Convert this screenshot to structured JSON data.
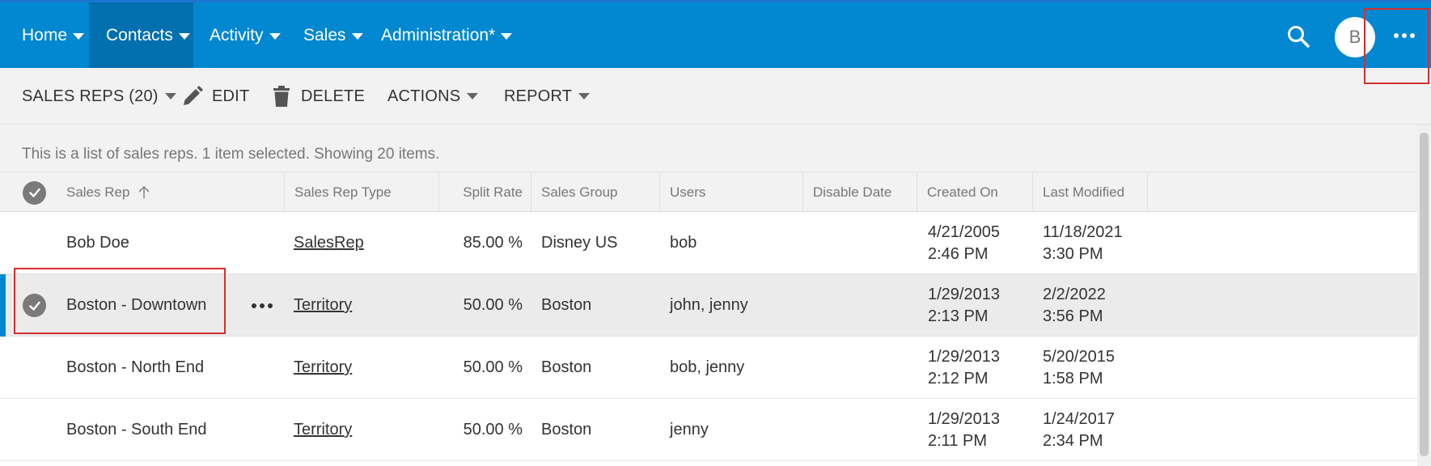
{
  "nav": {
    "items": [
      {
        "label": "Home"
      },
      {
        "label": "Contacts"
      },
      {
        "label": "Activity"
      },
      {
        "label": "Sales"
      },
      {
        "label": "Administration*"
      }
    ],
    "avatar_initial": "B",
    "accent_color": "#0288d1"
  },
  "toolbar": {
    "view_label": "SALES REPS (20)",
    "edit_label": "EDIT",
    "delete_label": "DELETE",
    "actions_label": "ACTIONS",
    "report_label": "REPORT"
  },
  "info": {
    "text": "This is a list of sales reps. 1 item selected. Showing 20 items."
  },
  "table": {
    "columns": [
      "Sales Rep",
      "Sales Rep Type",
      "Split Rate",
      "Sales Group",
      "Users",
      "Disable Date",
      "Created On",
      "Last Modified"
    ],
    "rows": [
      {
        "name": "Bob Doe",
        "type": "SalesRep",
        "split": "85.00 %",
        "group": "Disney US",
        "users": "bob",
        "created_date": "4/21/2005",
        "created_time": "2:46 PM",
        "modified_date": "11/18/2021",
        "modified_time": "3:30 PM"
      },
      {
        "name": "Boston - Downtown",
        "type": "Territory",
        "split": "50.00 %",
        "group": "Boston",
        "users": "john, jenny",
        "created_date": "1/29/2013",
        "created_time": "2:13 PM",
        "modified_date": "2/2/2022",
        "modified_time": "3:56 PM"
      },
      {
        "name": "Boston - North End",
        "type": "Territory",
        "split": "50.00 %",
        "group": "Boston",
        "users": "bob, jenny",
        "created_date": "1/29/2013",
        "created_time": "2:12 PM",
        "modified_date": "5/20/2015",
        "modified_time": "1:58 PM"
      },
      {
        "name": "Boston - South End",
        "type": "Territory",
        "split": "50.00 %",
        "group": "Boston",
        "users": "jenny",
        "created_date": "1/29/2013",
        "created_time": "2:11 PM",
        "modified_date": "1/24/2017",
        "modified_time": "2:34 PM"
      }
    ]
  }
}
